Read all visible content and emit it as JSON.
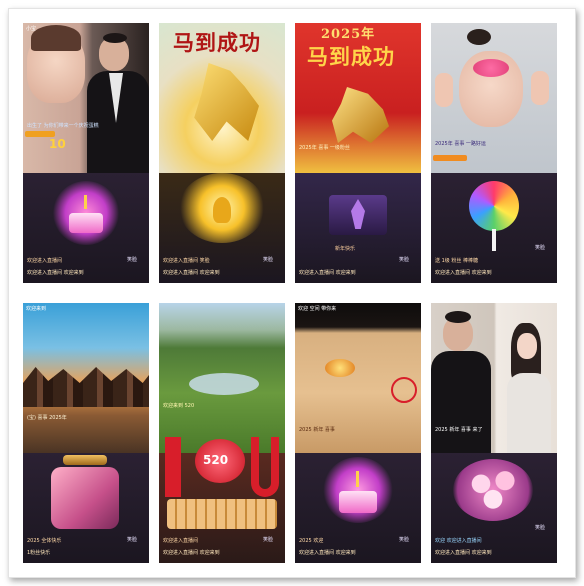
{
  "tiles": [
    {
      "header": "小宝",
      "title": "",
      "caption": "出生了 为你们带来一个庆祝蛋糕",
      "chat": [
        "欢迎进入直播间"
      ],
      "bottom": "欢迎进入直播间 欢迎来到",
      "gift": "cake-gift",
      "right_label": "笑脸"
    },
    {
      "header": "",
      "title": "马到成功",
      "caption": "",
      "chat": [
        "欢迎进入直播间 笑脸"
      ],
      "bottom": "欢迎进入直播间 欢迎来到",
      "gift": "microphone-gift",
      "right_label": "笑脸"
    },
    {
      "header": "",
      "title": "马到成功",
      "year": "2025年",
      "caption": "2025年 喜事  一级粉丝",
      "chat": [
        "新年快乐"
      ],
      "bottom": "欢迎进入直播间 欢迎来到",
      "gift": "dancer-gift",
      "right_label": "笑脸"
    },
    {
      "header": "",
      "title": "",
      "caption": "2025年 喜事  一路好运",
      "chat": [
        "送 1级 粉丝 棒棒糖"
      ],
      "bottom": "欢迎进入直播间 欢迎来到",
      "gift": "lollipop-gift",
      "right_label": "笑脸"
    },
    {
      "header": "欢迎来到",
      "title": "",
      "caption": "(宝) 喜事  2025年",
      "chat": [
        "2025 全体快乐"
      ],
      "bottom": "1粉丝快乐",
      "gift": "perfume-gift",
      "right_label": "笑脸"
    },
    {
      "header": "",
      "title": "",
      "caption": "欢迎来到 520",
      "chat": [
        "欢迎进入直播间"
      ],
      "bottom": "欢迎进入直播间 欢迎来到",
      "gift": "i-love-u-gift",
      "love_number": "520",
      "right_label": "笑脸"
    },
    {
      "header": "欢迎 空间  带你来",
      "title": "",
      "caption": "2025 新年 喜事",
      "chat": [
        "2025 欢迎"
      ],
      "bottom": "欢迎进入直播间 欢迎来到",
      "gift": "cake-gift-2",
      "right_label": "笑脸"
    },
    {
      "header": "",
      "title": "",
      "caption": "2025 新年  喜事 来了",
      "chat": [
        "欢迎 欢迎进入直播间"
      ],
      "bottom": "欢迎进入直播间 欢迎来到",
      "gift": "flower-bouquet-gift",
      "right_label": "笑脸"
    }
  ],
  "colors": {
    "accent_red": "#d81e2a",
    "gold": "#f2b21c",
    "panel": "#221a2a"
  }
}
